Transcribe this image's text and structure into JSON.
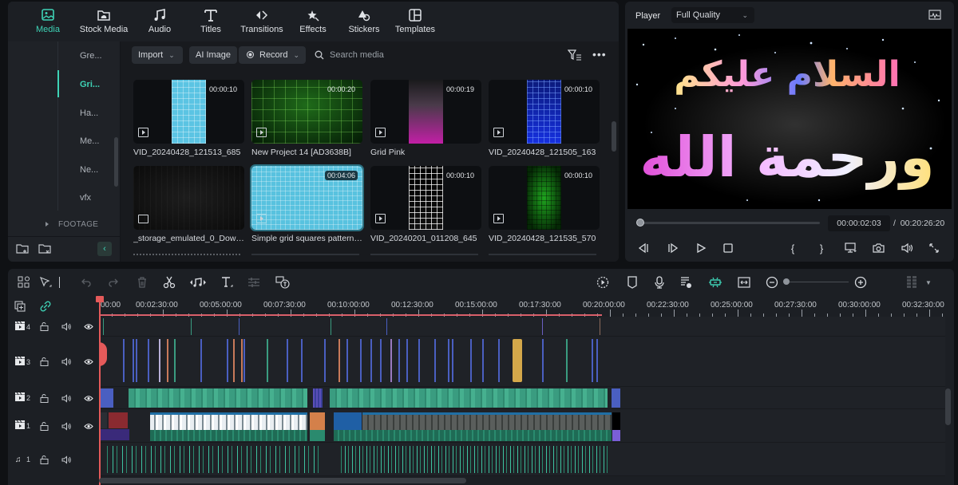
{
  "top_tabs": [
    {
      "label": "Media",
      "icon": "media-icon",
      "active": true
    },
    {
      "label": "Stock Media",
      "icon": "stock-media-icon"
    },
    {
      "label": "Audio",
      "icon": "music-note-icon"
    },
    {
      "label": "Titles",
      "icon": "title-t-icon"
    },
    {
      "label": "Transitions",
      "icon": "transitions-icon"
    },
    {
      "label": "Effects",
      "icon": "effects-sparkle-icon"
    },
    {
      "label": "Stickers",
      "icon": "stickers-icon"
    },
    {
      "label": "Templates",
      "icon": "templates-icon"
    }
  ],
  "folder_tree": {
    "items": [
      {
        "label": "Gre..."
      },
      {
        "label": "Gri...",
        "active": true
      },
      {
        "label": "Ha..."
      },
      {
        "label": "Me..."
      },
      {
        "label": "Ne..."
      },
      {
        "label": "vfx"
      }
    ],
    "section": "FOOTAGE"
  },
  "media_toolbar": {
    "import_label": "Import",
    "ai_image_label": "AI Image",
    "record_label": "Record",
    "search_placeholder": "Search media"
  },
  "media_items": [
    {
      "name": "VID_20240428_121513_685",
      "duration": "00:00:10",
      "type": "video",
      "thumb": "cyan-grid-vertical"
    },
    {
      "name": "New Project 14 [AD3638B]",
      "duration": "00:00:20",
      "type": "video",
      "thumb": "green-grid"
    },
    {
      "name": "Grid Pink",
      "duration": "00:00:19",
      "type": "video",
      "thumb": "pink-gradient"
    },
    {
      "name": "VID_20240428_121505_163",
      "duration": "00:00:10",
      "type": "video",
      "thumb": "blue-grid-vertical"
    },
    {
      "name": "_storage_emulated_0_Downl...",
      "duration": "",
      "type": "image",
      "thumb": "dark"
    },
    {
      "name": "Simple grid squares pattern i...",
      "duration": "00:04:06",
      "type": "video",
      "thumb": "cyan-grid",
      "selected": true
    },
    {
      "name": "VID_20240201_011208_645",
      "duration": "00:00:10",
      "type": "video",
      "thumb": "white-grid-vertical"
    },
    {
      "name": "VID_20240428_121535_570",
      "duration": "00:00:10",
      "type": "video",
      "thumb": "green-grid-vertical"
    }
  ],
  "player": {
    "label": "Player",
    "quality": "Full Quality",
    "preview_text_line1": "السلام عليكم",
    "preview_text_line2": "ورحمة الله",
    "current_time": "00:00:02:03",
    "separator": "/",
    "total_time": "00:20:26:20",
    "progress_fraction": 0.002
  },
  "timeline": {
    "ruler_labels": [
      "00:00",
      "00:02:30:00",
      "00:05:00:00",
      "00:07:30:00",
      "00:10:00:00",
      "00:12:30:00",
      "00:15:00:00",
      "00:17:30:00",
      "00:20:00:00",
      "00:22:30:00",
      "00:25:00:00",
      "00:27:30:00",
      "00:30:00:00",
      "00:32:30:00"
    ],
    "tracks": [
      {
        "type": "video",
        "number": "4"
      },
      {
        "type": "video",
        "number": "3"
      },
      {
        "type": "video",
        "number": "2"
      },
      {
        "type": "video",
        "number": "1"
      },
      {
        "type": "audio",
        "number": "1"
      }
    ]
  },
  "colors": {
    "accent": "#3ed3b6",
    "playhead": "#e55a5a",
    "clip_green": "#3a9c80",
    "clip_blue": "#4a5fc1",
    "clip_gold": "#d4a84a"
  }
}
